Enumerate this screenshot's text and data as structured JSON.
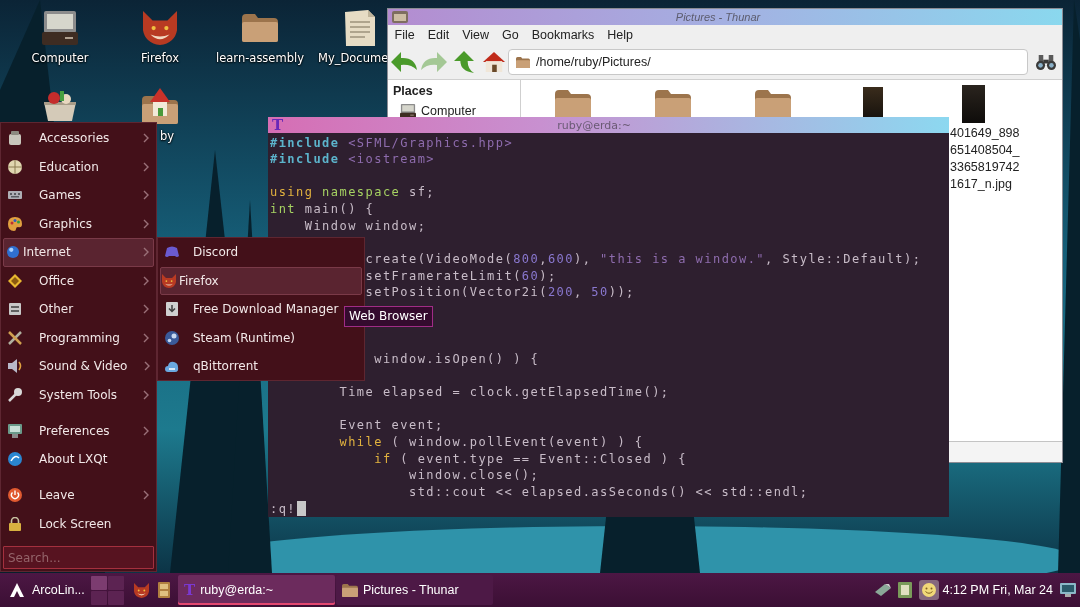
{
  "desktop": {
    "icons": [
      {
        "label": "Computer"
      },
      {
        "label": "Firefox"
      },
      {
        "label": "learn-assembly"
      },
      {
        "label": "My_Docume"
      },
      {
        "label": "by"
      }
    ]
  },
  "file_manager": {
    "title": "Pictures - Thunar",
    "menu": [
      "File",
      "Edit",
      "View",
      "Go",
      "Bookmarks",
      "Help"
    ],
    "nav_buttons": [
      {
        "disabled": false
      },
      {
        "disabled": true
      },
      {
        "disabled": false
      },
      {
        "disabled": false
      }
    ],
    "location": {
      "value": "/home/ruby/Pictures/"
    },
    "sidebar": {
      "heading": "Places",
      "items": [
        {
          "label": "Computer"
        }
      ]
    },
    "files": [
      {
        "kind": "folder"
      },
      {
        "kind": "folder"
      },
      {
        "kind": "folder"
      },
      {
        "kind": "photo"
      },
      {
        "kind": "photo",
        "name_lines": [
          "401649_898",
          "651408504_",
          "3365819742",
          "1617_n.jpg"
        ]
      }
    ]
  },
  "terminal": {
    "icon": "T",
    "title": "ruby@erda:~",
    "lines": [
      {
        "kind": "code",
        "tokens": [
          {
            "text": "#include",
            "kind": "preproc"
          },
          {
            "text": " <SFML/Graphics.hpp>",
            "kind": "string"
          }
        ]
      },
      {
        "kind": "code",
        "tokens": [
          {
            "text": "#include",
            "kind": "preproc"
          },
          {
            "text": " <iostream>",
            "kind": "string"
          }
        ]
      },
      {
        "kind": "blank"
      },
      {
        "kind": "code",
        "tokens": [
          {
            "text": "using",
            "kind": "keyword"
          },
          {
            "text": " namespace",
            "kind": "type"
          },
          {
            "text": " sf;",
            "kind": "plain"
          }
        ]
      },
      {
        "kind": "code",
        "tokens": [
          {
            "text": "int",
            "kind": "type"
          },
          {
            "text": " main() {",
            "kind": "plain"
          }
        ]
      },
      {
        "kind": "code",
        "tokens": [
          {
            "text": "    Window window;",
            "kind": "plain"
          }
        ]
      },
      {
        "kind": "blank"
      },
      {
        "kind": "code",
        "tokens": [
          {
            "text": "           create(VideoMode(",
            "kind": "plain"
          },
          {
            "text": "800",
            "kind": "number"
          },
          {
            "text": ",",
            "kind": "plain"
          },
          {
            "text": "600",
            "kind": "number"
          },
          {
            "text": "), ",
            "kind": "plain"
          },
          {
            "text": "\"this is a window.\"",
            "kind": "string"
          },
          {
            "text": ", Style::Default);",
            "kind": "plain"
          }
        ]
      },
      {
        "kind": "code",
        "tokens": [
          {
            "text": "           setFramerateLimit(",
            "kind": "plain"
          },
          {
            "text": "60",
            "kind": "number"
          },
          {
            "text": ");",
            "kind": "plain"
          }
        ]
      },
      {
        "kind": "code",
        "tokens": [
          {
            "text": "           setPosition(Vector2i(",
            "kind": "plain"
          },
          {
            "text": "200",
            "kind": "number"
          },
          {
            "text": ", ",
            "kind": "plain"
          },
          {
            "text": "50",
            "kind": "number"
          },
          {
            "text": "));",
            "kind": "plain"
          }
        ]
      },
      {
        "kind": "blank"
      },
      {
        "kind": "blank"
      },
      {
        "kind": "blank"
      },
      {
        "kind": "code",
        "tokens": [
          {
            "text": "            window.isOpen() ) {",
            "kind": "plain"
          }
        ]
      },
      {
        "kind": "blank"
      },
      {
        "kind": "code",
        "tokens": [
          {
            "text": "        Time elapsed = clock.getElapsedTime();",
            "kind": "plain"
          }
        ]
      },
      {
        "kind": "blank"
      },
      {
        "kind": "code",
        "tokens": [
          {
            "text": "        Event event;",
            "kind": "plain"
          }
        ]
      },
      {
        "kind": "code",
        "tokens": [
          {
            "text": "        while",
            "kind": "keyword"
          },
          {
            "text": " ( window.pollEvent(event) ) {",
            "kind": "plain"
          }
        ]
      },
      {
        "kind": "code",
        "tokens": [
          {
            "text": "            if",
            "kind": "keyword"
          },
          {
            "text": " ( event.type == Event::Closed ) {",
            "kind": "plain"
          }
        ]
      },
      {
        "kind": "code",
        "tokens": [
          {
            "text": "                window.close();",
            "kind": "plain"
          }
        ]
      },
      {
        "kind": "code",
        "tokens": [
          {
            "text": "                std::cout << elapsed.asSeconds() << std::endl;",
            "kind": "plain"
          }
        ]
      }
    ],
    "command": ":q!"
  },
  "menu": {
    "groups": [
      [
        {
          "label": "Accessories",
          "submenu": true,
          "selected": false
        },
        {
          "label": "Education",
          "submenu": true,
          "selected": false
        },
        {
          "label": "Games",
          "submenu": true,
          "selected": false
        },
        {
          "label": "Graphics",
          "submenu": true,
          "selected": false
        },
        {
          "label": "Internet",
          "submenu": true,
          "selected": true
        },
        {
          "label": "Office",
          "submenu": true,
          "selected": false
        },
        {
          "label": "Other",
          "submenu": true,
          "selected": false
        },
        {
          "label": "Programming",
          "submenu": true,
          "selected": false
        },
        {
          "label": "Sound & Video",
          "submenu": true,
          "selected": false
        },
        {
          "label": "System Tools",
          "submenu": true,
          "selected": false
        }
      ],
      [
        {
          "label": "Preferences",
          "submenu": true,
          "selected": false
        },
        {
          "label": "About LXQt",
          "submenu": false,
          "selected": false
        }
      ],
      [
        {
          "label": "Leave",
          "submenu": true,
          "selected": false
        },
        {
          "label": "Lock Screen",
          "submenu": false,
          "selected": false
        }
      ]
    ],
    "search": {
      "placeholder": "Search..."
    }
  },
  "submenu": {
    "items": [
      {
        "label": "Discord",
        "selected": false
      },
      {
        "label": "Firefox",
        "selected": true
      },
      {
        "label": "Free Download Manager",
        "selected": false
      },
      {
        "label": "Steam (Runtime)",
        "selected": false
      },
      {
        "label": "qBittorrent",
        "selected": false
      }
    ]
  },
  "tooltip": {
    "text": "Web Browser"
  },
  "taskbar": {
    "start": {
      "label": "ArcoLin..."
    },
    "desktops": [
      {
        "selected": true
      },
      {
        "selected": false
      },
      {
        "selected": false
      },
      {
        "selected": false
      }
    ],
    "tasks": [
      {
        "kind": "terminal",
        "icon": "T",
        "label": "ruby@erda:~",
        "selected": true
      },
      {
        "kind": "file-manager",
        "label": "Pictures - Thunar",
        "selected": false
      }
    ],
    "clock": "4:12 PM Fri, Mar 24"
  }
}
